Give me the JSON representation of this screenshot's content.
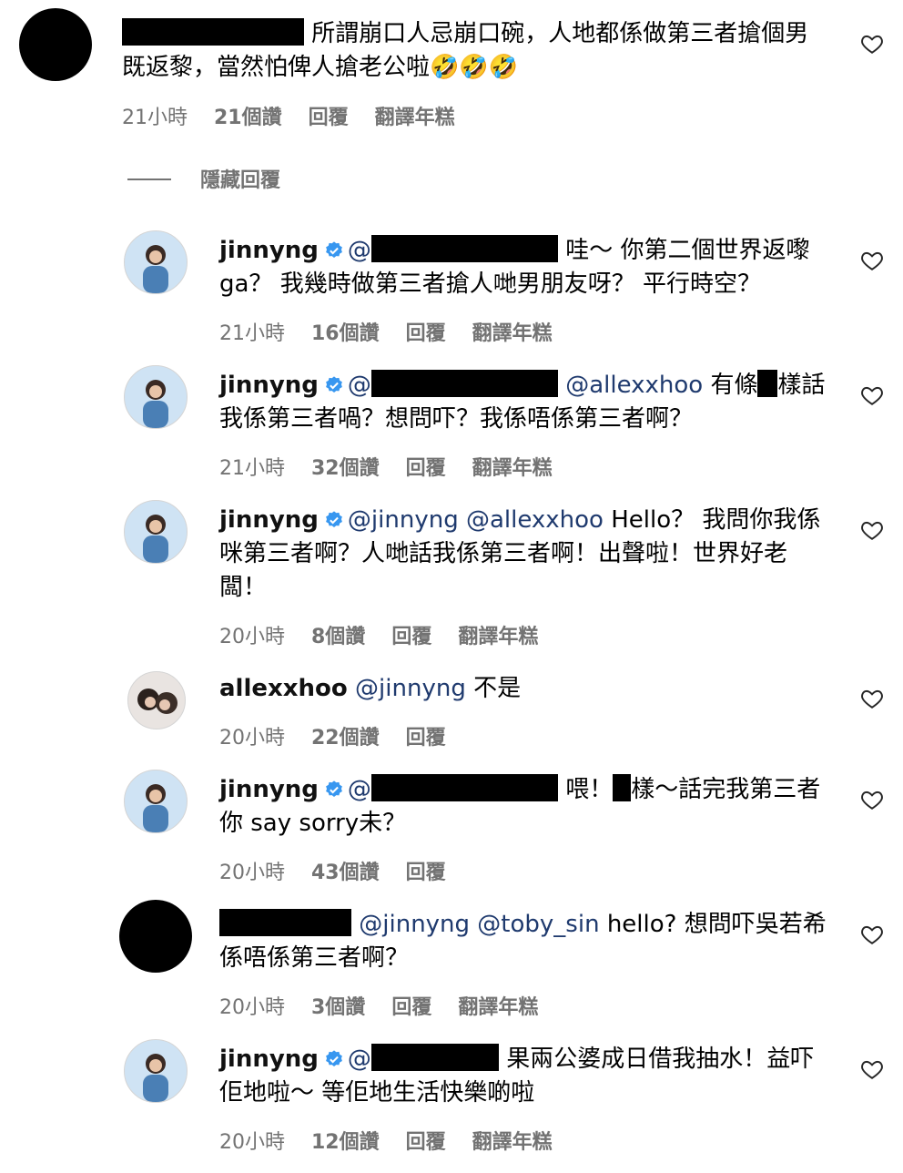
{
  "comments": [
    {
      "text": "所謂崩口人忌崩口碗，人地都係做第三者搶個男既返黎，當然怕俾人搶老公啦🤣🤣🤣",
      "time": "21小時",
      "likes": "21個讚",
      "reply": "回覆",
      "translate": "翻譯年糕"
    },
    {
      "username": "jinnyng",
      "prefix": "@",
      "text": "哇～ 你第二個世界返嚟ga？ 我幾時做第三者搶人哋男朋友呀？ 平行時空？",
      "time": "21小時",
      "likes": "16個讚",
      "reply": "回覆",
      "translate": "翻譯年糕"
    },
    {
      "username": "jinnyng",
      "prefix": "@",
      "mention": "@allexxhoo",
      "text_a": "有條",
      "text_b": "樣話我係第三者喎？想問吓？我係唔係第三者啊？",
      "time": "21小時",
      "likes": "32個讚",
      "reply": "回覆",
      "translate": "翻譯年糕"
    },
    {
      "username": "jinnyng",
      "mention": "@jinnyng @allexxhoo",
      "text": "Hello？ 我問你我係咪第三者啊？人哋話我係第三者啊！出聲啦！世界好老闆！",
      "time": "20小時",
      "likes": "8個讚",
      "reply": "回覆",
      "translate": "翻譯年糕"
    },
    {
      "username": "allexxhoo",
      "mention": "@jinnyng",
      "text": "不是",
      "time": "20小時",
      "likes": "22個讚",
      "reply": "回覆"
    },
    {
      "username": "jinnyng",
      "prefix": "@",
      "text_a": "喂！",
      "text_b": "樣～話完我第三者你 say sorry未？",
      "time": "20小時",
      "likes": "43個讚",
      "reply": "回覆"
    },
    {
      "mention": "@jinnyng @toby_sin",
      "text": "hello? 想問吓吳若希係唔係第三者啊？",
      "time": "20小時",
      "likes": "3個讚",
      "reply": "回覆",
      "translate": "翻譯年糕"
    },
    {
      "username": "jinnyng",
      "prefix": "@",
      "text": "果兩公婆成日借我抽水！益吓佢地啦～ 等佢地生活快樂啲啦",
      "time": "20小時",
      "likes": "12個讚",
      "reply": "回覆",
      "translate": "翻譯年糕"
    }
  ],
  "hide_replies": "隱藏回覆",
  "colors": {
    "mention": "#1f3a6e",
    "meta": "#737373",
    "verified": "#3897f0"
  },
  "icons": {
    "like": "heart-outline-icon",
    "verified": "verified-badge-icon"
  }
}
